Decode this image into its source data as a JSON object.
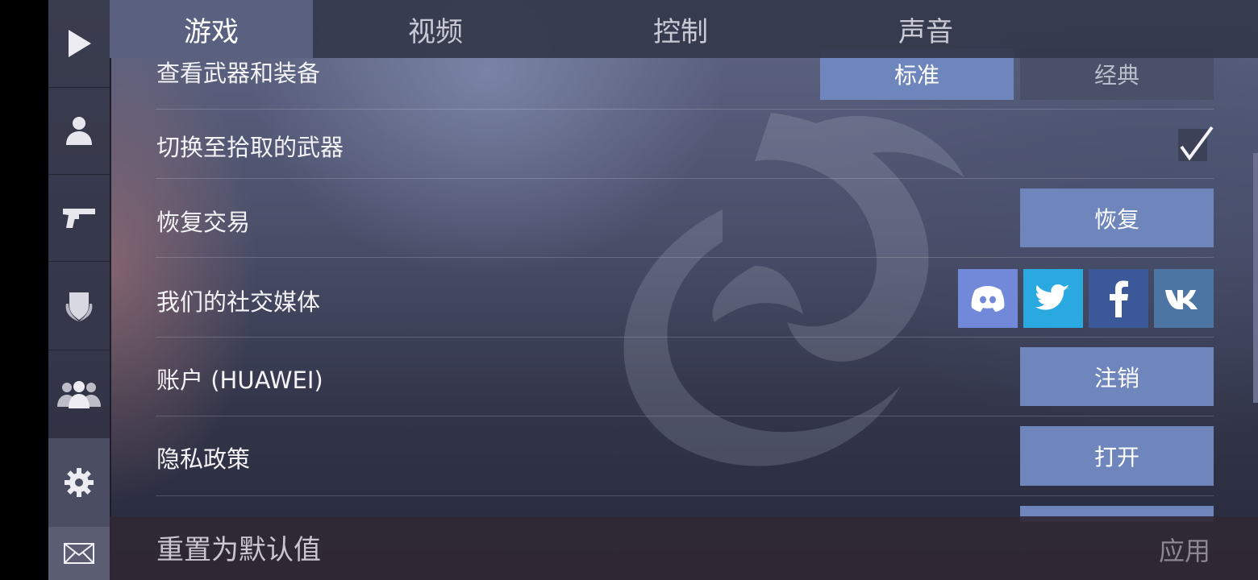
{
  "tabs": [
    {
      "label": "游戏",
      "active": true
    },
    {
      "label": "视频",
      "active": false
    },
    {
      "label": "控制",
      "active": false
    },
    {
      "label": "声音",
      "active": false
    }
  ],
  "sidebar": {
    "items": [
      {
        "icon": "play-icon"
      },
      {
        "icon": "profile-icon"
      },
      {
        "icon": "pistol-icon"
      },
      {
        "icon": "clan-shield-icon"
      },
      {
        "icon": "friends-icon"
      },
      {
        "icon": "gear-icon",
        "active": true
      },
      {
        "icon": "mail-icon"
      }
    ]
  },
  "settings": {
    "weapon_view": {
      "label": "查看武器和装备",
      "options": [
        "标准",
        "经典"
      ],
      "selected": "标准"
    },
    "switch_pickup": {
      "label": "切换至拾取的武器",
      "checked": true
    },
    "restore": {
      "label": "恢复交易",
      "button": "恢复"
    },
    "social": {
      "label": "我们的社交媒体",
      "links": [
        "discord-icon",
        "twitter-icon",
        "facebook-icon",
        "vk-icon"
      ]
    },
    "account": {
      "label": "账户 (HUAWEI)",
      "button": "注销"
    },
    "privacy": {
      "label": "隐私政策",
      "button": "打开"
    }
  },
  "footer": {
    "reset_label": "重置为默认值",
    "apply_label": "应用"
  },
  "colors": {
    "accent_button": "#6f86bd",
    "discord": "#7289da",
    "twitter": "#2aa9e0",
    "facebook": "#3b5998",
    "vk": "#4c75a3"
  }
}
